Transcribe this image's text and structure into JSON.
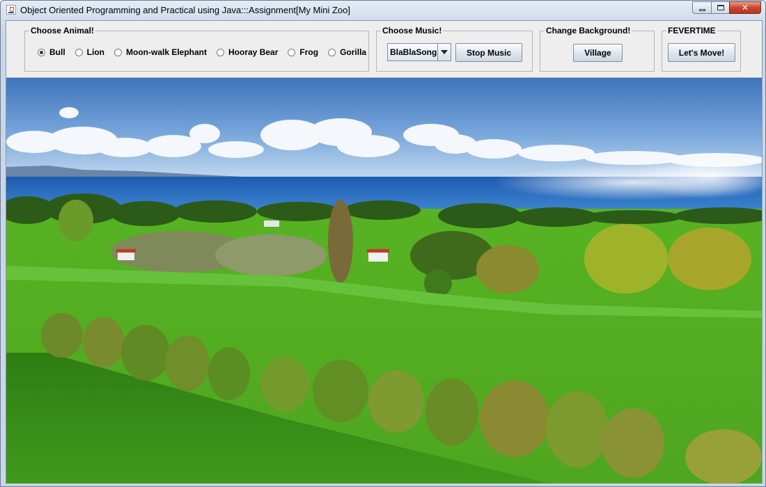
{
  "window": {
    "title": "Object Oriented Programming and Practical using Java:::Assignment[My Mini Zoo]"
  },
  "animal_group": {
    "legend": "Choose Animal!",
    "options": [
      {
        "label": "Bull",
        "checked": true
      },
      {
        "label": "Lion",
        "checked": false
      },
      {
        "label": "Moon-walk Elephant",
        "checked": false
      },
      {
        "label": "Hooray Bear",
        "checked": false
      },
      {
        "label": "Frog",
        "checked": false
      },
      {
        "label": "Gorilla",
        "checked": false
      }
    ]
  },
  "music_group": {
    "legend": "Choose Music!",
    "selected_song": "BlaBlaSong",
    "stop_label": "Stop Music"
  },
  "background_group": {
    "legend": "Change Background!",
    "button_label": "Village"
  },
  "fever_group": {
    "legend": "FEVERTIME",
    "button_label": "Let's Move!"
  },
  "icons": [
    "java-app-icon",
    "minimize-icon",
    "maximize-icon",
    "close-icon",
    "dropdown-arrow-icon"
  ],
  "colors": {
    "sky": "#4a82c6",
    "sea": "#2b6fc0",
    "grass": "#55b823",
    "close_button": "#c8472d"
  }
}
